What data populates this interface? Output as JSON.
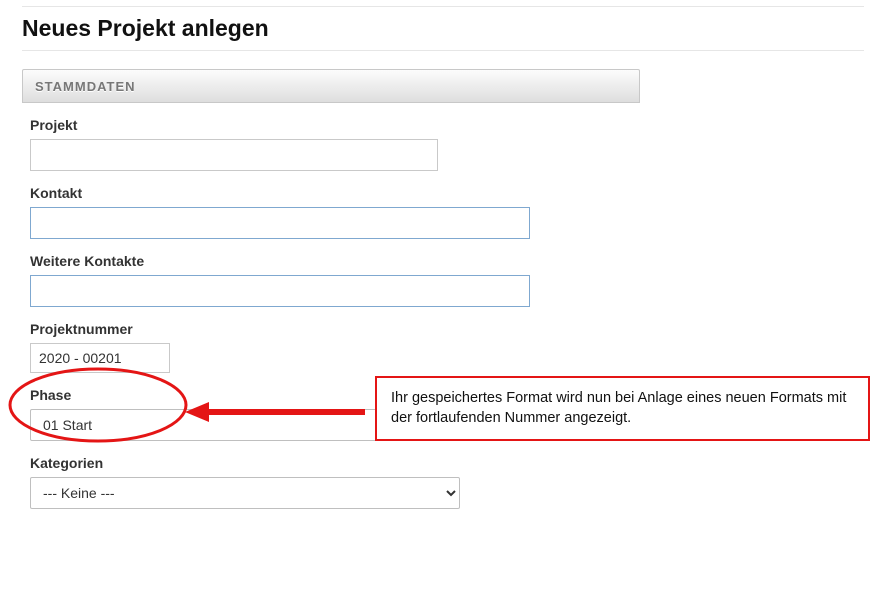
{
  "header": {
    "title": "Neues Projekt anlegen"
  },
  "section": {
    "stammdaten_label": "STAMMDATEN"
  },
  "fields": {
    "projekt": {
      "label": "Projekt",
      "value": ""
    },
    "kontakt": {
      "label": "Kontakt",
      "value": ""
    },
    "weitere_kontakte": {
      "label": "Weitere Kontakte",
      "value": ""
    },
    "projektnummer": {
      "label": "Projektnummer",
      "value": "2020 - 00201"
    },
    "phase": {
      "label": "Phase",
      "selected": "01 Start"
    },
    "kategorien": {
      "label": "Kategorien",
      "selected": "--- Keine ---"
    }
  },
  "annotation": {
    "text": "Ihr gespeichertes Format wird nun bei Anlage eines neuen Formats mit der fortlaufenden Nummer angezeigt.",
    "highlight_color": "#e41515"
  }
}
